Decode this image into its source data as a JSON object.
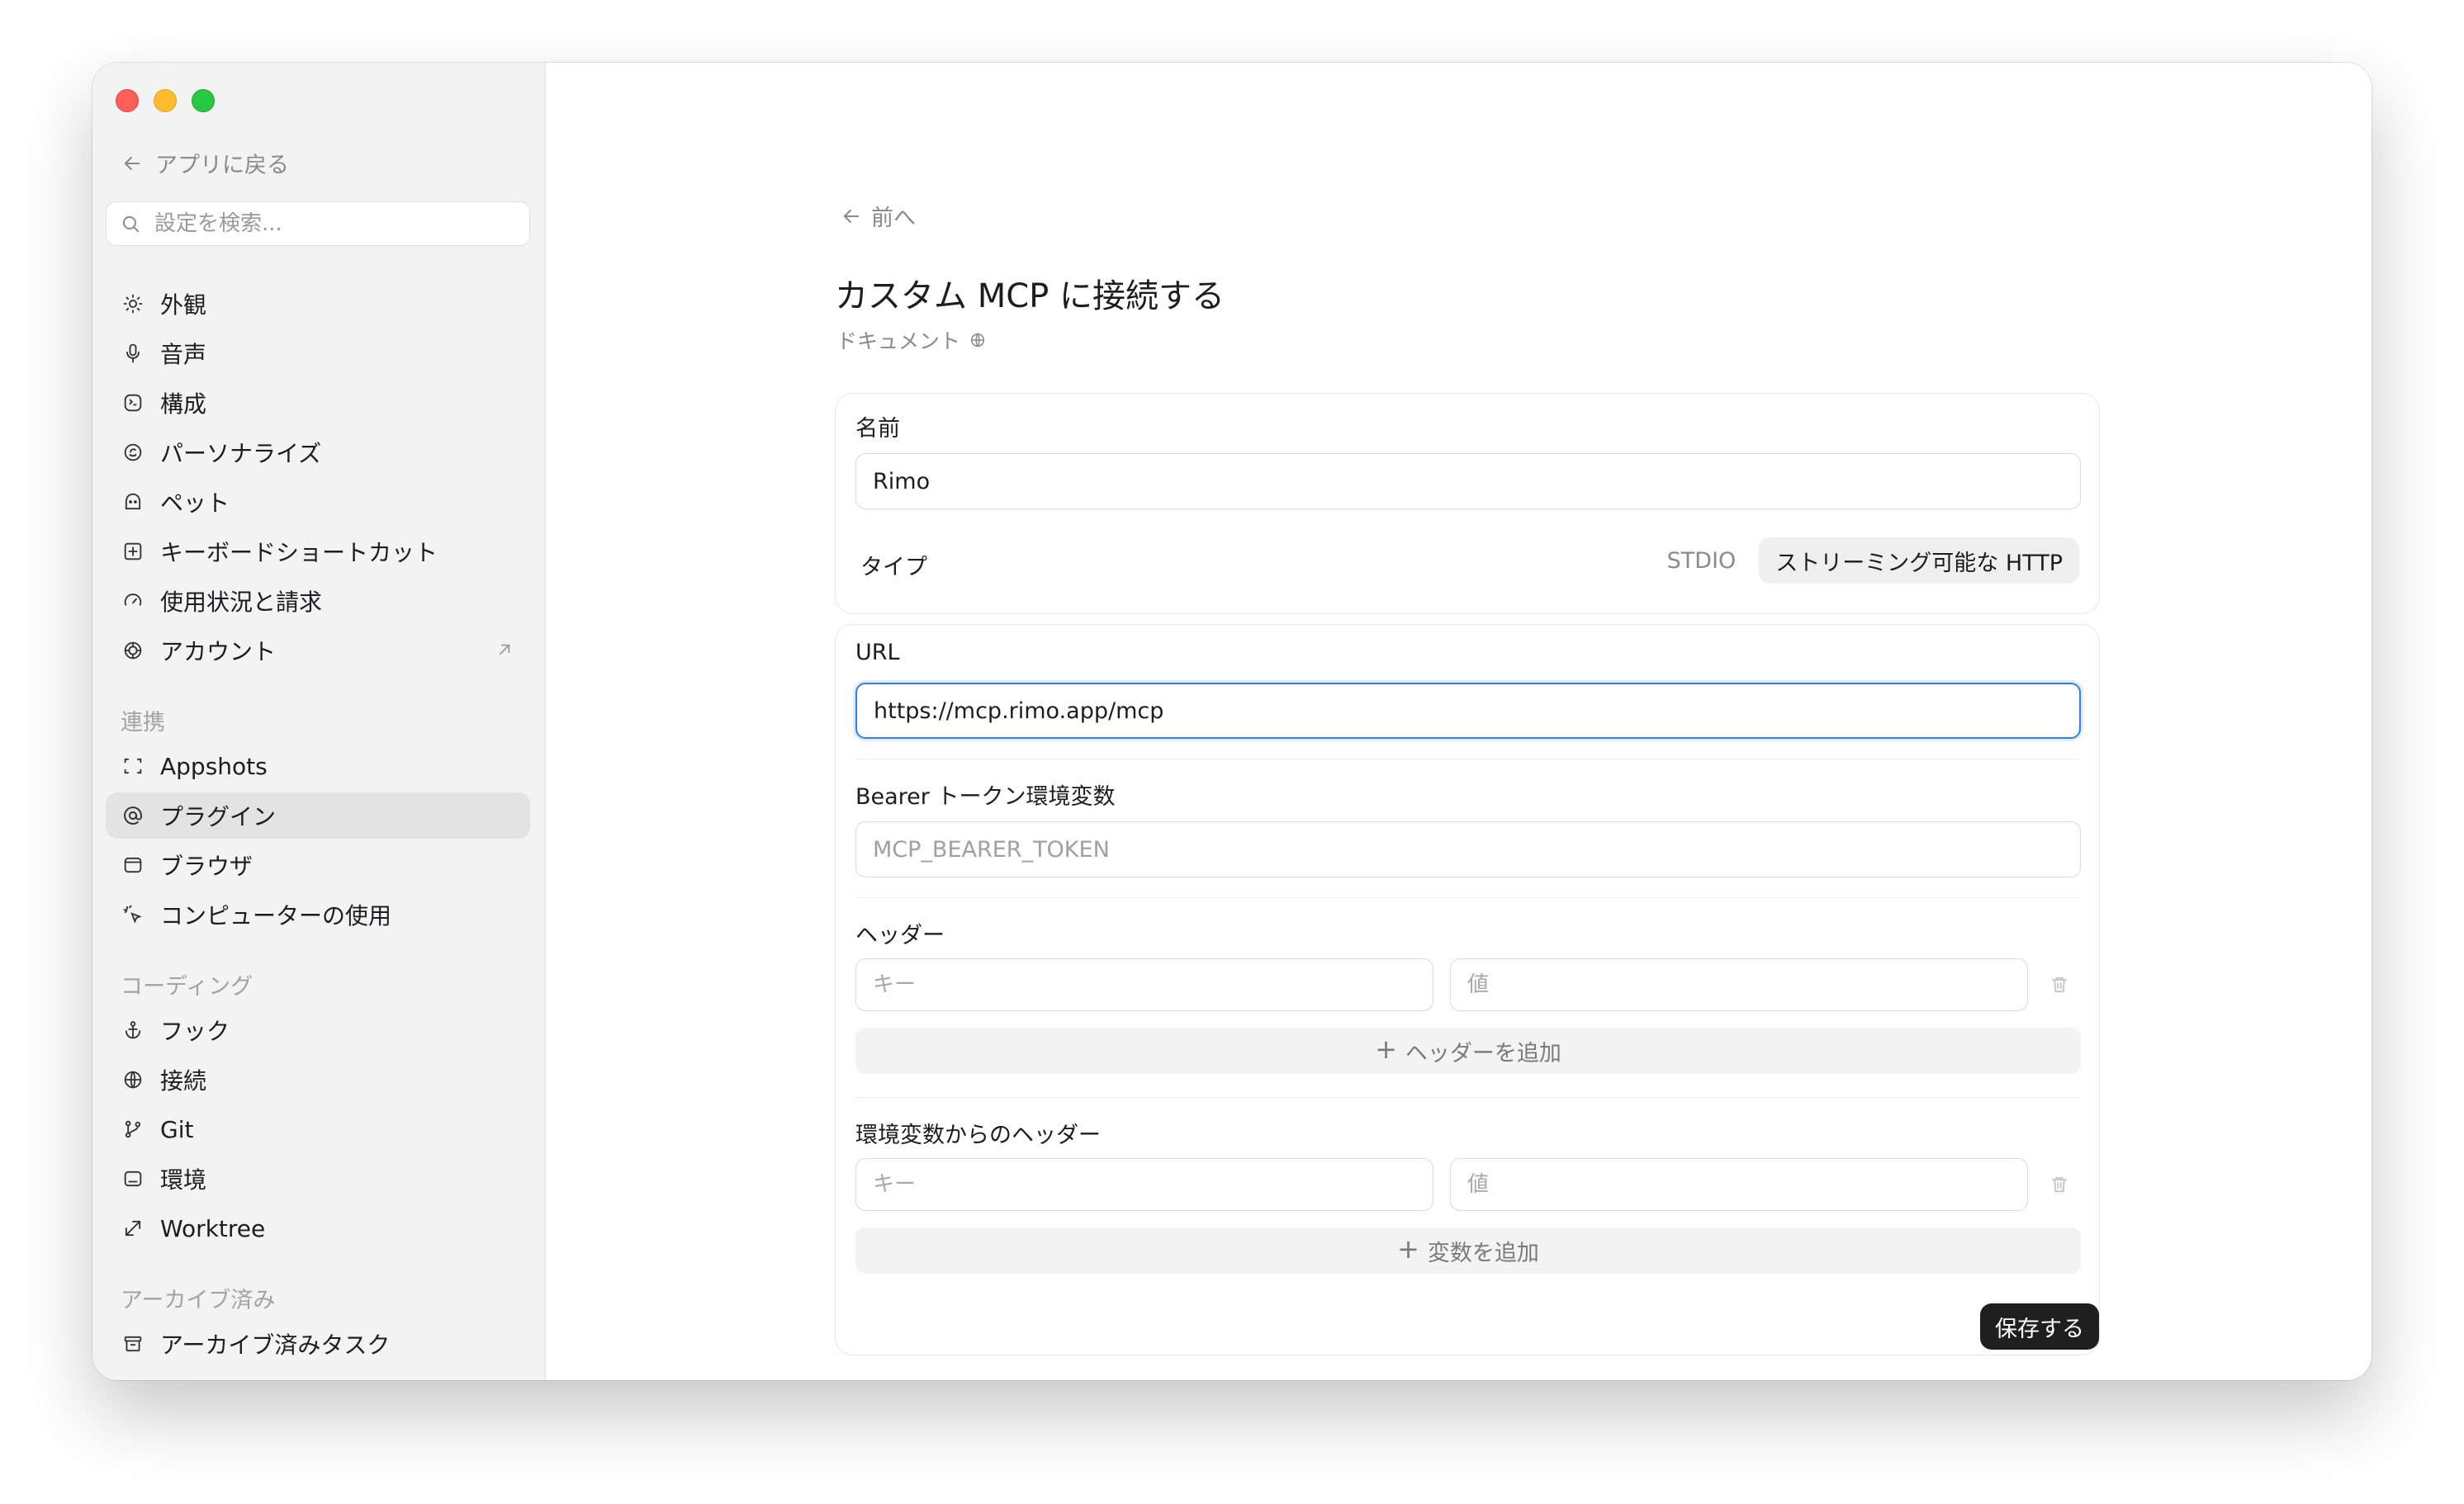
{
  "sidebar": {
    "back_label": "アプリに戻る",
    "search_placeholder": "設定を検索...",
    "items": [
      {
        "label": "外観",
        "icon": "sun-icon"
      },
      {
        "label": "音声",
        "icon": "microphone-icon"
      },
      {
        "label": "構成",
        "icon": "config-icon"
      },
      {
        "label": "パーソナライズ",
        "icon": "personalize-icon"
      },
      {
        "label": "ペット",
        "icon": "pet-icon"
      },
      {
        "label": "キーボードショートカット",
        "icon": "keyboard-icon"
      },
      {
        "label": "使用状況と請求",
        "icon": "gauge-icon"
      },
      {
        "label": "アカウント",
        "icon": "account-icon"
      }
    ],
    "sections": {
      "integrations": {
        "title": "連携",
        "items": [
          {
            "label": "Appshots",
            "icon": "screenshot-icon"
          },
          {
            "label": "プラグイン",
            "icon": "at-icon"
          },
          {
            "label": "ブラウザ",
            "icon": "browser-icon"
          },
          {
            "label": "コンピューターの使用",
            "icon": "cursor-icon"
          }
        ]
      },
      "coding": {
        "title": "コーディング",
        "items": [
          {
            "label": "フック",
            "icon": "anchor-icon"
          },
          {
            "label": "接続",
            "icon": "globe-icon"
          },
          {
            "label": "Git",
            "icon": "git-branch-icon"
          },
          {
            "label": "環境",
            "icon": "environment-icon"
          },
          {
            "label": "Worktree",
            "icon": "worktree-icon"
          }
        ]
      },
      "archived": {
        "title": "アーカイブ済み",
        "items": [
          {
            "label": "アーカイブ済みタスク",
            "icon": "archive-icon"
          }
        ]
      }
    },
    "active_item": "プラグイン"
  },
  "main": {
    "prev_label": "前へ",
    "title": "カスタム MCP に接続する",
    "doc_link": "ドキュメント",
    "name_label": "名前",
    "name_value": "Rimo",
    "type_label": "タイプ",
    "type_options": [
      "STDIO",
      "ストリーミング可能な HTTP"
    ],
    "type_selected": "ストリーミング可能な HTTP",
    "url_label": "URL",
    "url_value": "https://mcp.rimo.app/mcp",
    "bearer_label": "Bearer トークン環境変数",
    "bearer_placeholder": "MCP_BEARER_TOKEN",
    "headers_label": "ヘッダー",
    "key_placeholder": "キー",
    "value_placeholder": "値",
    "add_header_label": "ヘッダーを追加",
    "env_headers_label": "環境変数からのヘッダー",
    "add_variable_label": "変数を追加",
    "save_label": "保存する"
  },
  "colors": {
    "sidebar_bg": "#f3f3f3",
    "active_item_bg": "#e3e3e3",
    "focus_border": "#2f80ed",
    "save_button_bg": "#1f1f1f"
  }
}
